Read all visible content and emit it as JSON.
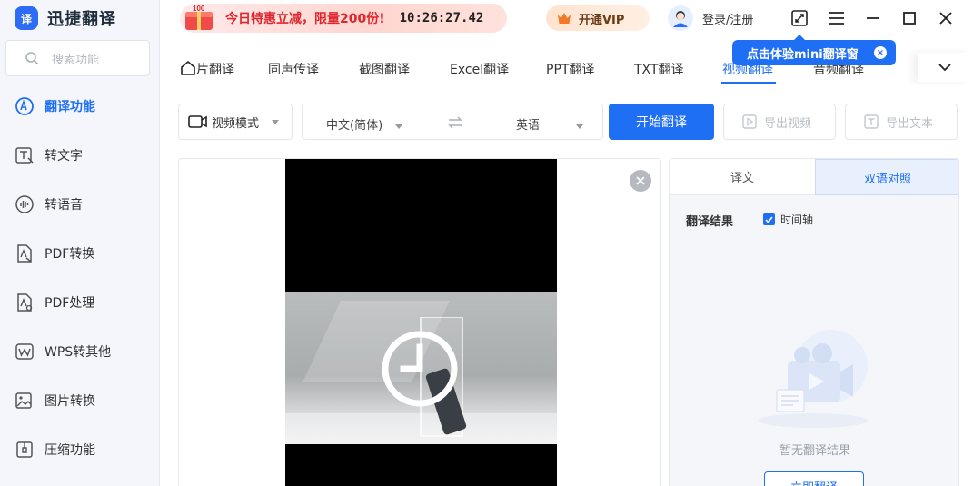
{
  "app": {
    "logo_mark": "译",
    "title": "迅捷翻译"
  },
  "search": {
    "placeholder": "搜索功能"
  },
  "sidebar": {
    "items": [
      {
        "label": "翻译功能",
        "icon": "translate-icon",
        "active": true
      },
      {
        "label": "转文字",
        "icon": "text-convert-icon"
      },
      {
        "label": "转语音",
        "icon": "voice-icon"
      },
      {
        "label": "PDF转换",
        "icon": "pdf-convert-icon"
      },
      {
        "label": "PDF处理",
        "icon": "pdf-process-icon"
      },
      {
        "label": "WPS转其他",
        "icon": "wps-icon"
      },
      {
        "label": "图片转换",
        "icon": "image-convert-icon"
      },
      {
        "label": "压缩功能",
        "icon": "compress-icon"
      }
    ]
  },
  "topbar": {
    "promo_badge": "100",
    "promo_text": "今日特惠立减，限量200份!",
    "promo_time": "10:26:27.42",
    "vip_label": "开通VIP",
    "login_label": "登录/注册"
  },
  "tooltip": {
    "text": "点击体验mini翻译窗",
    "close": "×"
  },
  "tabs": [
    {
      "label": "片翻译"
    },
    {
      "label": "同声传译"
    },
    {
      "label": "截图翻译"
    },
    {
      "label": "Excel翻译"
    },
    {
      "label": "PPT翻译"
    },
    {
      "label": "TXT翻译"
    },
    {
      "label": "视频翻译",
      "active": true
    },
    {
      "label": "音频翻译"
    }
  ],
  "toolbar": {
    "mode_label": "视频模式",
    "source_lang": "中文(简体)",
    "target_lang": "英语",
    "start_label": "开始翻译",
    "export_video_label": "导出视频",
    "export_text_label": "导出文本"
  },
  "result": {
    "tab_translation": "译文",
    "tab_bilingual": "双语对照",
    "label": "翻译结果",
    "timeline_label": "时间轴",
    "timeline_checked": true,
    "empty_text": "暂无翻译结果",
    "now_button": "立即翻译"
  },
  "colors": {
    "accent": "#1f6ff5",
    "promo_red": "#e0262d"
  }
}
